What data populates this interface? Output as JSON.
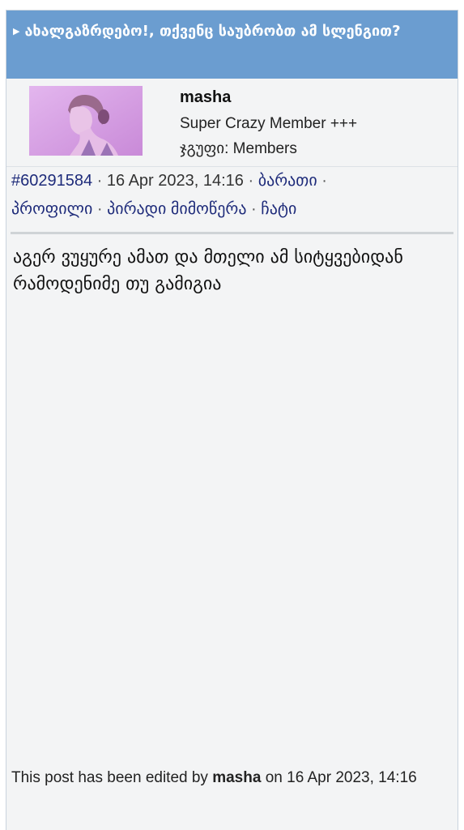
{
  "thread": {
    "title": "ახალგაზრდებო!, თქვენც საუბრობთ ამ სლენგით?"
  },
  "post": {
    "author": {
      "name": "masha",
      "rank": "Super Crazy Member +++",
      "group_label": "ჯგუფი:",
      "group": "Members"
    },
    "id": "#60291584",
    "date": "16 Apr 2023, 14:16",
    "links": {
      "card": "ბარათი",
      "profile": "პროფილი",
      "private_message": "პირადი მიმოწერა",
      "chat": "ჩატი"
    },
    "body": "აგერ ვუყურე ამათ და მთელი ამ სიტყვებიდან რამოდენიმე თუ გამიგია",
    "edited": {
      "prefix": "This post has been edited by",
      "editor": "masha",
      "on": "on",
      "date": "16 Apr 2023, 14:16"
    }
  },
  "colors": {
    "header_bg": "#6b9dd0",
    "link": "#1e2b7a",
    "avatar_tint": "#d9a2e4"
  }
}
